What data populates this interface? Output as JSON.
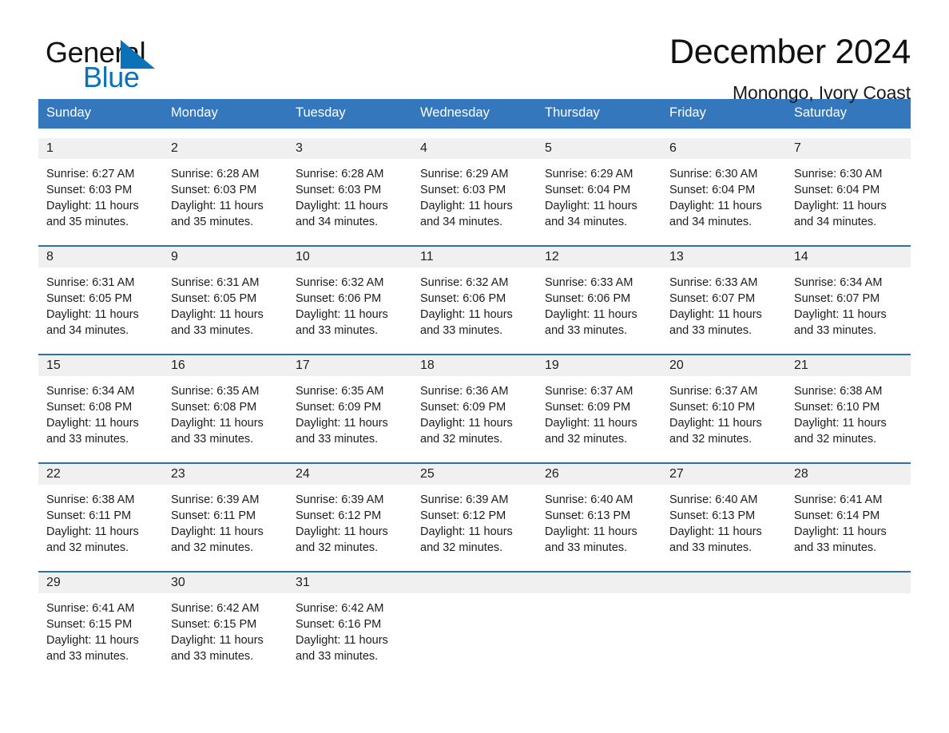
{
  "brand": {
    "word_general": "General",
    "word_blue": "Blue",
    "triangle_color": "#0b72ba",
    "blue_text_color": "#0b72ba"
  },
  "header": {
    "title": "December 2024",
    "subtitle": "Monongo, Ivory Coast",
    "header_bg": "#3577bd",
    "row_divider": "#2e6fb0",
    "daynum_band_bg": "#f0f0f0"
  },
  "weekdays": [
    "Sunday",
    "Monday",
    "Tuesday",
    "Wednesday",
    "Thursday",
    "Friday",
    "Saturday"
  ],
  "weeks": [
    [
      {
        "day": "1",
        "sunrise": "Sunrise: 6:27 AM",
        "sunset": "Sunset: 6:03 PM",
        "daylight_1": "Daylight: 11 hours",
        "daylight_2": "and 35 minutes."
      },
      {
        "day": "2",
        "sunrise": "Sunrise: 6:28 AM",
        "sunset": "Sunset: 6:03 PM",
        "daylight_1": "Daylight: 11 hours",
        "daylight_2": "and 35 minutes."
      },
      {
        "day": "3",
        "sunrise": "Sunrise: 6:28 AM",
        "sunset": "Sunset: 6:03 PM",
        "daylight_1": "Daylight: 11 hours",
        "daylight_2": "and 34 minutes."
      },
      {
        "day": "4",
        "sunrise": "Sunrise: 6:29 AM",
        "sunset": "Sunset: 6:03 PM",
        "daylight_1": "Daylight: 11 hours",
        "daylight_2": "and 34 minutes."
      },
      {
        "day": "5",
        "sunrise": "Sunrise: 6:29 AM",
        "sunset": "Sunset: 6:04 PM",
        "daylight_1": "Daylight: 11 hours",
        "daylight_2": "and 34 minutes."
      },
      {
        "day": "6",
        "sunrise": "Sunrise: 6:30 AM",
        "sunset": "Sunset: 6:04 PM",
        "daylight_1": "Daylight: 11 hours",
        "daylight_2": "and 34 minutes."
      },
      {
        "day": "7",
        "sunrise": "Sunrise: 6:30 AM",
        "sunset": "Sunset: 6:04 PM",
        "daylight_1": "Daylight: 11 hours",
        "daylight_2": "and 34 minutes."
      }
    ],
    [
      {
        "day": "8",
        "sunrise": "Sunrise: 6:31 AM",
        "sunset": "Sunset: 6:05 PM",
        "daylight_1": "Daylight: 11 hours",
        "daylight_2": "and 34 minutes."
      },
      {
        "day": "9",
        "sunrise": "Sunrise: 6:31 AM",
        "sunset": "Sunset: 6:05 PM",
        "daylight_1": "Daylight: 11 hours",
        "daylight_2": "and 33 minutes."
      },
      {
        "day": "10",
        "sunrise": "Sunrise: 6:32 AM",
        "sunset": "Sunset: 6:06 PM",
        "daylight_1": "Daylight: 11 hours",
        "daylight_2": "and 33 minutes."
      },
      {
        "day": "11",
        "sunrise": "Sunrise: 6:32 AM",
        "sunset": "Sunset: 6:06 PM",
        "daylight_1": "Daylight: 11 hours",
        "daylight_2": "and 33 minutes."
      },
      {
        "day": "12",
        "sunrise": "Sunrise: 6:33 AM",
        "sunset": "Sunset: 6:06 PM",
        "daylight_1": "Daylight: 11 hours",
        "daylight_2": "and 33 minutes."
      },
      {
        "day": "13",
        "sunrise": "Sunrise: 6:33 AM",
        "sunset": "Sunset: 6:07 PM",
        "daylight_1": "Daylight: 11 hours",
        "daylight_2": "and 33 minutes."
      },
      {
        "day": "14",
        "sunrise": "Sunrise: 6:34 AM",
        "sunset": "Sunset: 6:07 PM",
        "daylight_1": "Daylight: 11 hours",
        "daylight_2": "and 33 minutes."
      }
    ],
    [
      {
        "day": "15",
        "sunrise": "Sunrise: 6:34 AM",
        "sunset": "Sunset: 6:08 PM",
        "daylight_1": "Daylight: 11 hours",
        "daylight_2": "and 33 minutes."
      },
      {
        "day": "16",
        "sunrise": "Sunrise: 6:35 AM",
        "sunset": "Sunset: 6:08 PM",
        "daylight_1": "Daylight: 11 hours",
        "daylight_2": "and 33 minutes."
      },
      {
        "day": "17",
        "sunrise": "Sunrise: 6:35 AM",
        "sunset": "Sunset: 6:09 PM",
        "daylight_1": "Daylight: 11 hours",
        "daylight_2": "and 33 minutes."
      },
      {
        "day": "18",
        "sunrise": "Sunrise: 6:36 AM",
        "sunset": "Sunset: 6:09 PM",
        "daylight_1": "Daylight: 11 hours",
        "daylight_2": "and 32 minutes."
      },
      {
        "day": "19",
        "sunrise": "Sunrise: 6:37 AM",
        "sunset": "Sunset: 6:09 PM",
        "daylight_1": "Daylight: 11 hours",
        "daylight_2": "and 32 minutes."
      },
      {
        "day": "20",
        "sunrise": "Sunrise: 6:37 AM",
        "sunset": "Sunset: 6:10 PM",
        "daylight_1": "Daylight: 11 hours",
        "daylight_2": "and 32 minutes."
      },
      {
        "day": "21",
        "sunrise": "Sunrise: 6:38 AM",
        "sunset": "Sunset: 6:10 PM",
        "daylight_1": "Daylight: 11 hours",
        "daylight_2": "and 32 minutes."
      }
    ],
    [
      {
        "day": "22",
        "sunrise": "Sunrise: 6:38 AM",
        "sunset": "Sunset: 6:11 PM",
        "daylight_1": "Daylight: 11 hours",
        "daylight_2": "and 32 minutes."
      },
      {
        "day": "23",
        "sunrise": "Sunrise: 6:39 AM",
        "sunset": "Sunset: 6:11 PM",
        "daylight_1": "Daylight: 11 hours",
        "daylight_2": "and 32 minutes."
      },
      {
        "day": "24",
        "sunrise": "Sunrise: 6:39 AM",
        "sunset": "Sunset: 6:12 PM",
        "daylight_1": "Daylight: 11 hours",
        "daylight_2": "and 32 minutes."
      },
      {
        "day": "25",
        "sunrise": "Sunrise: 6:39 AM",
        "sunset": "Sunset: 6:12 PM",
        "daylight_1": "Daylight: 11 hours",
        "daylight_2": "and 32 minutes."
      },
      {
        "day": "26",
        "sunrise": "Sunrise: 6:40 AM",
        "sunset": "Sunset: 6:13 PM",
        "daylight_1": "Daylight: 11 hours",
        "daylight_2": "and 33 minutes."
      },
      {
        "day": "27",
        "sunrise": "Sunrise: 6:40 AM",
        "sunset": "Sunset: 6:13 PM",
        "daylight_1": "Daylight: 11 hours",
        "daylight_2": "and 33 minutes."
      },
      {
        "day": "28",
        "sunrise": "Sunrise: 6:41 AM",
        "sunset": "Sunset: 6:14 PM",
        "daylight_1": "Daylight: 11 hours",
        "daylight_2": "and 33 minutes."
      }
    ],
    [
      {
        "day": "29",
        "sunrise": "Sunrise: 6:41 AM",
        "sunset": "Sunset: 6:15 PM",
        "daylight_1": "Daylight: 11 hours",
        "daylight_2": "and 33 minutes."
      },
      {
        "day": "30",
        "sunrise": "Sunrise: 6:42 AM",
        "sunset": "Sunset: 6:15 PM",
        "daylight_1": "Daylight: 11 hours",
        "daylight_2": "and 33 minutes."
      },
      {
        "day": "31",
        "sunrise": "Sunrise: 6:42 AM",
        "sunset": "Sunset: 6:16 PM",
        "daylight_1": "Daylight: 11 hours",
        "daylight_2": "and 33 minutes."
      },
      {
        "day": "",
        "sunrise": "",
        "sunset": "",
        "daylight_1": "",
        "daylight_2": ""
      },
      {
        "day": "",
        "sunrise": "",
        "sunset": "",
        "daylight_1": "",
        "daylight_2": ""
      },
      {
        "day": "",
        "sunrise": "",
        "sunset": "",
        "daylight_1": "",
        "daylight_2": ""
      },
      {
        "day": "",
        "sunrise": "",
        "sunset": "",
        "daylight_1": "",
        "daylight_2": ""
      }
    ]
  ]
}
